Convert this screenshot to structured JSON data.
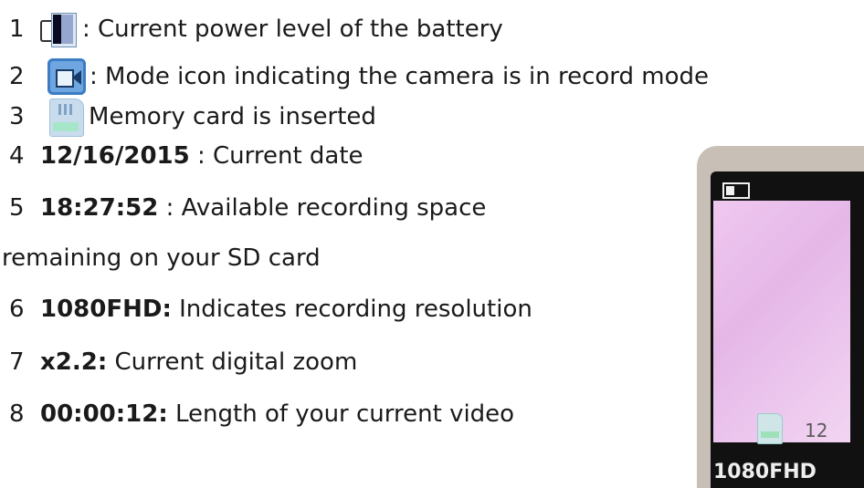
{
  "items": [
    {
      "number": "1",
      "text": ": Current power level of the battery",
      "icon": "battery-icon"
    },
    {
      "number": "2",
      "text": ": Mode icon indicating the camera is in record mode",
      "icon": "video-camera-icon"
    },
    {
      "number": "3",
      "text": ": Memory card is inserted",
      "icon": "sd-card-icon"
    },
    {
      "number": "4",
      "term": "12/16/2015",
      "text": " : Current date"
    },
    {
      "number": "5",
      "term": "18:27:52",
      "text": " : Available recording space"
    },
    {
      "continuation": "remaining on your SD card"
    },
    {
      "number": "6",
      "term": "1080FHD:",
      "text": " Indicates recording resolution"
    },
    {
      "number": "7",
      "term": "x2.2:",
      "text": " Current digital zoom"
    },
    {
      "number": "8",
      "term": "00:00:12:",
      "text": " Length of your current video"
    }
  ],
  "photo": {
    "date_fragment": "12",
    "resolution_fragment": "1080FHD"
  },
  "colors": {
    "text": "#1a1a1a",
    "lcd_pink": "#e5b7e8",
    "icon_blue": "#6fa6df"
  }
}
